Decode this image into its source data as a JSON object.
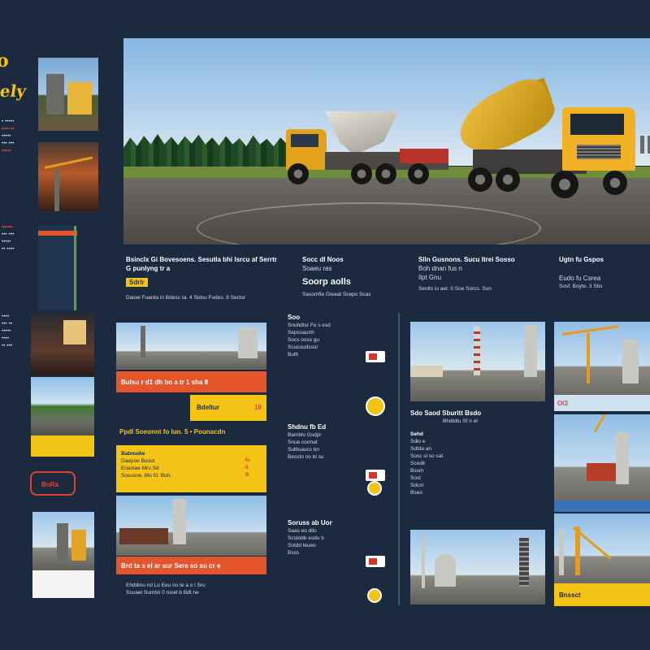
{
  "logo": {
    "mark": "o",
    "word": "ely"
  },
  "colors": {
    "background": "#1b2a3f",
    "accent_yellow": "#f3c316",
    "accent_orange": "#e4552c",
    "accent_red": "#e0402c"
  },
  "left_rail": {
    "lines_top": [
      "• •••••",
      "•••• ••",
      "•••••",
      "••• •••",
      "•••••"
    ],
    "lines_mid": [
      "••••••",
      "••• •••",
      "•••••",
      "•• ••••"
    ],
    "lines_low": [
      "••••",
      "••• ••",
      "•••••",
      "••••",
      "•• •••"
    ]
  },
  "row_two": {
    "col1": {
      "line1": "Bsinclx Gi Bovesoens. Sesutla bhi Isrcu af Serrtr",
      "line2": "G punlyng tr a",
      "tag": "Sdrlr",
      "line3": "Daswi Fuarda in Bdesc ra. 4 Sidsu Fodes. 8 Sectsr"
    },
    "col2": {
      "line1": "Socc dl Noos",
      "line2": "Soaeu ras",
      "heading": "Soorp aolls",
      "line3": "Sasomfie Gieaat Scepo Scas"
    },
    "col3": {
      "line1": "Slln Gusnons. Sucu Itrei Sosso",
      "line2": "Boh dnan fus n",
      "line3": "Ilpt Gnu",
      "line4": "Seolts iu aet. 0 Soe Sorcs. Sun"
    },
    "col4": {
      "line1": "Ugtn fu Gspos",
      "line2": "Eudo fu Csrea",
      "line3": "Sosf. Boyte. 3 Sbs"
    }
  },
  "section_a": {
    "orange_bar_1": "Bulsu r d1 dh bo a tr 1 sha 8",
    "yellow_tag": "Bdeltur",
    "yellow_num": "18",
    "heading": "Ppdl Soeonnt fo lun. 5 • Pounacdn",
    "block": [
      "Babnudw",
      "Daepoe Buoot",
      "Eoaniae Mru Sd",
      "Sosusne. Mo fd. Boh."
    ],
    "block_nums": [
      "fu",
      "8",
      "B"
    ],
    "orange_bar_2": "Brd ta s el ar sur Sere so su cr e",
    "footer": [
      "Ehddinu rol Lo Eeu nu te a o l Sru",
      "Ssuaet Sumtin 0 rusel b Bdt ne"
    ]
  },
  "section_b": {
    "items": [
      {
        "title": "Soo",
        "lines": [
          "Snuhdtsr Fo s esd",
          "Sepcoaunh",
          "Socs ooss gu",
          "Scucoudssur",
          "Buth"
        ]
      },
      {
        "title": "Shdnu fb Ed",
        "lines": [
          "Bamblo Gsdpl",
          "Snue coonat",
          "Sulbsaucs bn",
          "Bessto no bl su"
        ]
      },
      {
        "title": "Soruss ab Uor",
        "lines": [
          "Saas eo dilo",
          "Scstobb esdu b",
          "Sotdd leueo",
          "Bsss"
        ]
      }
    ]
  },
  "section_c": {
    "caption_line1": "Sdo Saod Sburitt Bsdo",
    "caption_line2": "Bhdtdtu Sf n el",
    "list": [
      "Sehd",
      "Sdlo e",
      "Sdtda an",
      "Sosc sl so sat",
      "Scedlr",
      "Bssm",
      "Sosl",
      "Sdcsl",
      "Bseo"
    ]
  },
  "section_d": {
    "tag": "Ol3",
    "footer_tag": "Bnssct"
  },
  "left_red_box": "BnRa"
}
